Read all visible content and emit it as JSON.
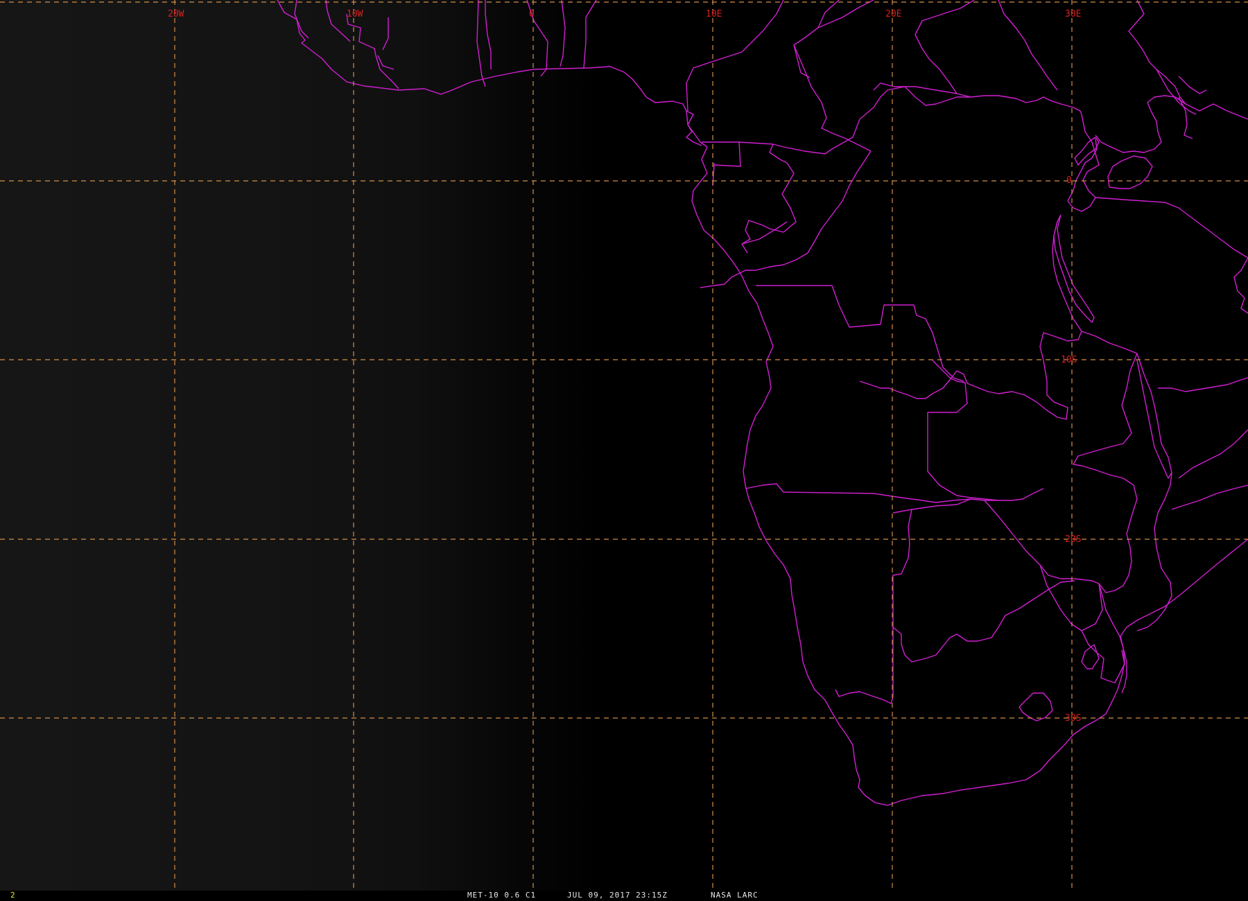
{
  "viewer": {
    "frame_number": "2",
    "status": {
      "satellite": "MET-10 0.6 C1",
      "datetime": "JUL 09, 2017 23:15Z",
      "source": "NASA LARC"
    }
  },
  "grid": {
    "longitude_labels": [
      "20W",
      "10W",
      "0",
      "10E",
      "20E",
      "30E"
    ],
    "latitude_labels": [
      "0",
      "10S",
      "20S",
      "30S"
    ]
  },
  "colors": {
    "background": "#000000",
    "grid_lines": "#d4904a",
    "grid_labels": "#d82020",
    "boundaries": "#d21fd2",
    "status_text": "#e8e8e8",
    "frame_number": "#e8e820"
  }
}
